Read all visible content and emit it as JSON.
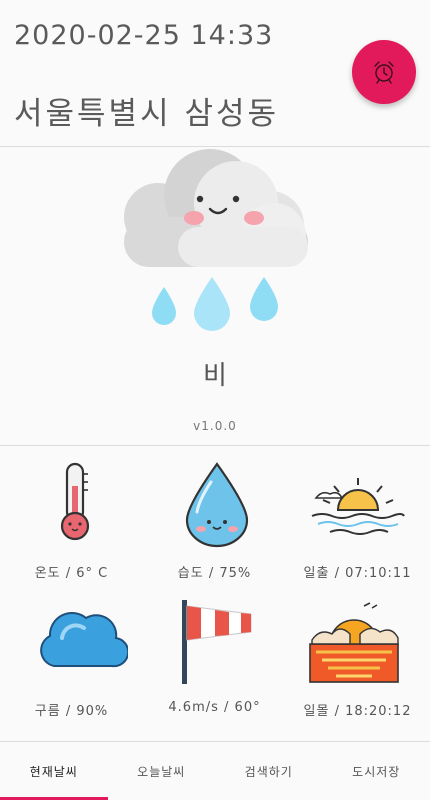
{
  "header": {
    "datetime": "2020-02-25 14:33",
    "location": "서울특별시 삼성동",
    "alarm_icon": "alarm-clock-icon"
  },
  "current": {
    "icon": "rain-cloud-icon",
    "weather": "비",
    "version": "v1.0.0"
  },
  "details": [
    {
      "icon": "thermometer-icon",
      "label": "온도 / 6° C"
    },
    {
      "icon": "water-drop-icon",
      "label": "습도 / 75%"
    },
    {
      "icon": "sunrise-icon",
      "label": "일출 / 07:10:11"
    },
    {
      "icon": "cloud-icon",
      "label": "구름 / 90%"
    },
    {
      "icon": "windsock-icon",
      "label": "4.6m/s / 60°"
    },
    {
      "icon": "sunset-icon",
      "label": "일몰 / 18:20:12"
    }
  ],
  "nav": {
    "items": [
      {
        "label": "현재날씨",
        "active": true
      },
      {
        "label": "오늘날씨",
        "active": false
      },
      {
        "label": "검색하기",
        "active": false
      },
      {
        "label": "도시저장",
        "active": false
      }
    ]
  },
  "colors": {
    "accent": "#e2195b",
    "background": "#fafafa",
    "text": "#555555"
  }
}
